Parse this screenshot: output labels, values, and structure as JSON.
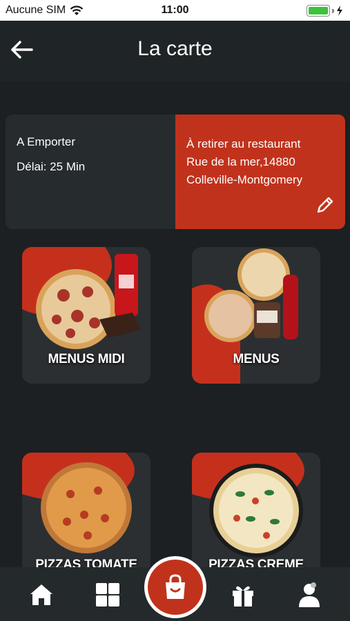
{
  "status_bar": {
    "carrier": "Aucune SIM",
    "time": "11:00"
  },
  "header": {
    "title": "La carte"
  },
  "order_info": {
    "mode": "A Emporter",
    "delay": "Délai: 25 Min",
    "pickup_line1": "À retirer au restaurant",
    "pickup_line2": "Rue de la mer,14880",
    "pickup_line3": "Colleville-Montgomery"
  },
  "categories": [
    {
      "label": "MENUS MIDI"
    },
    {
      "label": "MENUS"
    },
    {
      "label": "PIZZAS TOMATE"
    },
    {
      "label": "PIZZAS CREME"
    }
  ],
  "nav": {
    "items": [
      "home-icon",
      "grid-icon",
      "shopping-bag-icon",
      "gift-icon",
      "user-icon"
    ]
  },
  "colors": {
    "accent": "#c1321c",
    "background": "#1c2022",
    "card": "#262b2e"
  }
}
